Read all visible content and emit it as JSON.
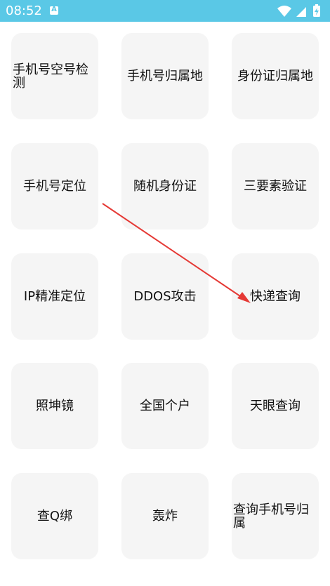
{
  "status_bar": {
    "time": "08:52",
    "app_icon_letter": "A",
    "icons": [
      "wifi-icon",
      "cellular-signal-icon",
      "battery-charging-icon"
    ],
    "background_color": "#5ac8e6"
  },
  "tiles": [
    {
      "label": "手机号空号检测"
    },
    {
      "label": "手机号归属地"
    },
    {
      "label": "身份证归属地"
    },
    {
      "label": "手机号定位"
    },
    {
      "label": "随机身份证"
    },
    {
      "label": "三要素验证"
    },
    {
      "label": "IP精准定位"
    },
    {
      "label": "DDOS攻击"
    },
    {
      "label": "快递查询"
    },
    {
      "label": "照坤镜"
    },
    {
      "label": "全国个户"
    },
    {
      "label": "天眼查询"
    },
    {
      "label": "查Q绑"
    },
    {
      "label": "轰炸"
    },
    {
      "label": "查询手机号归属"
    }
  ],
  "annotation": {
    "arrow_color": "#e53935"
  }
}
